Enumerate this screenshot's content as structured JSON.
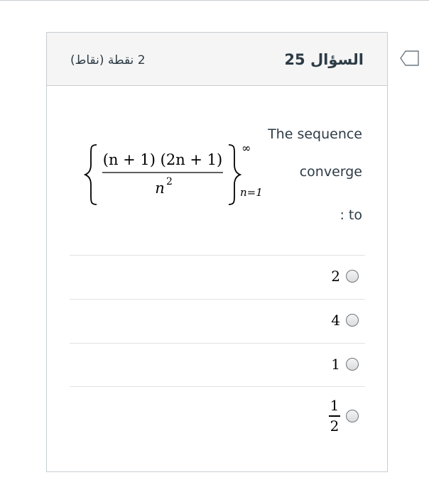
{
  "question": {
    "title": "السؤال 25",
    "points": "2 نقطة (نقاط)",
    "text_line1": "The sequence",
    "text_line2": "converge",
    "text_line3": ": to",
    "formula": {
      "numerator": "(n + 1) (2n + 1)",
      "denominator": "n",
      "denominator_exponent": "2",
      "upper_limit": "∞",
      "lower_limit": "n=1"
    }
  },
  "answers": [
    {
      "label": "2"
    },
    {
      "label": "4"
    },
    {
      "label": "1"
    },
    {
      "numerator": "1",
      "denominator": "2"
    }
  ],
  "icons": {
    "flag": "flag-icon",
    "radio": "radio-button-icon"
  },
  "colors": {
    "header_bg": "#f5f5f5",
    "border": "#c7cdd1",
    "text": "#2d3b45"
  }
}
